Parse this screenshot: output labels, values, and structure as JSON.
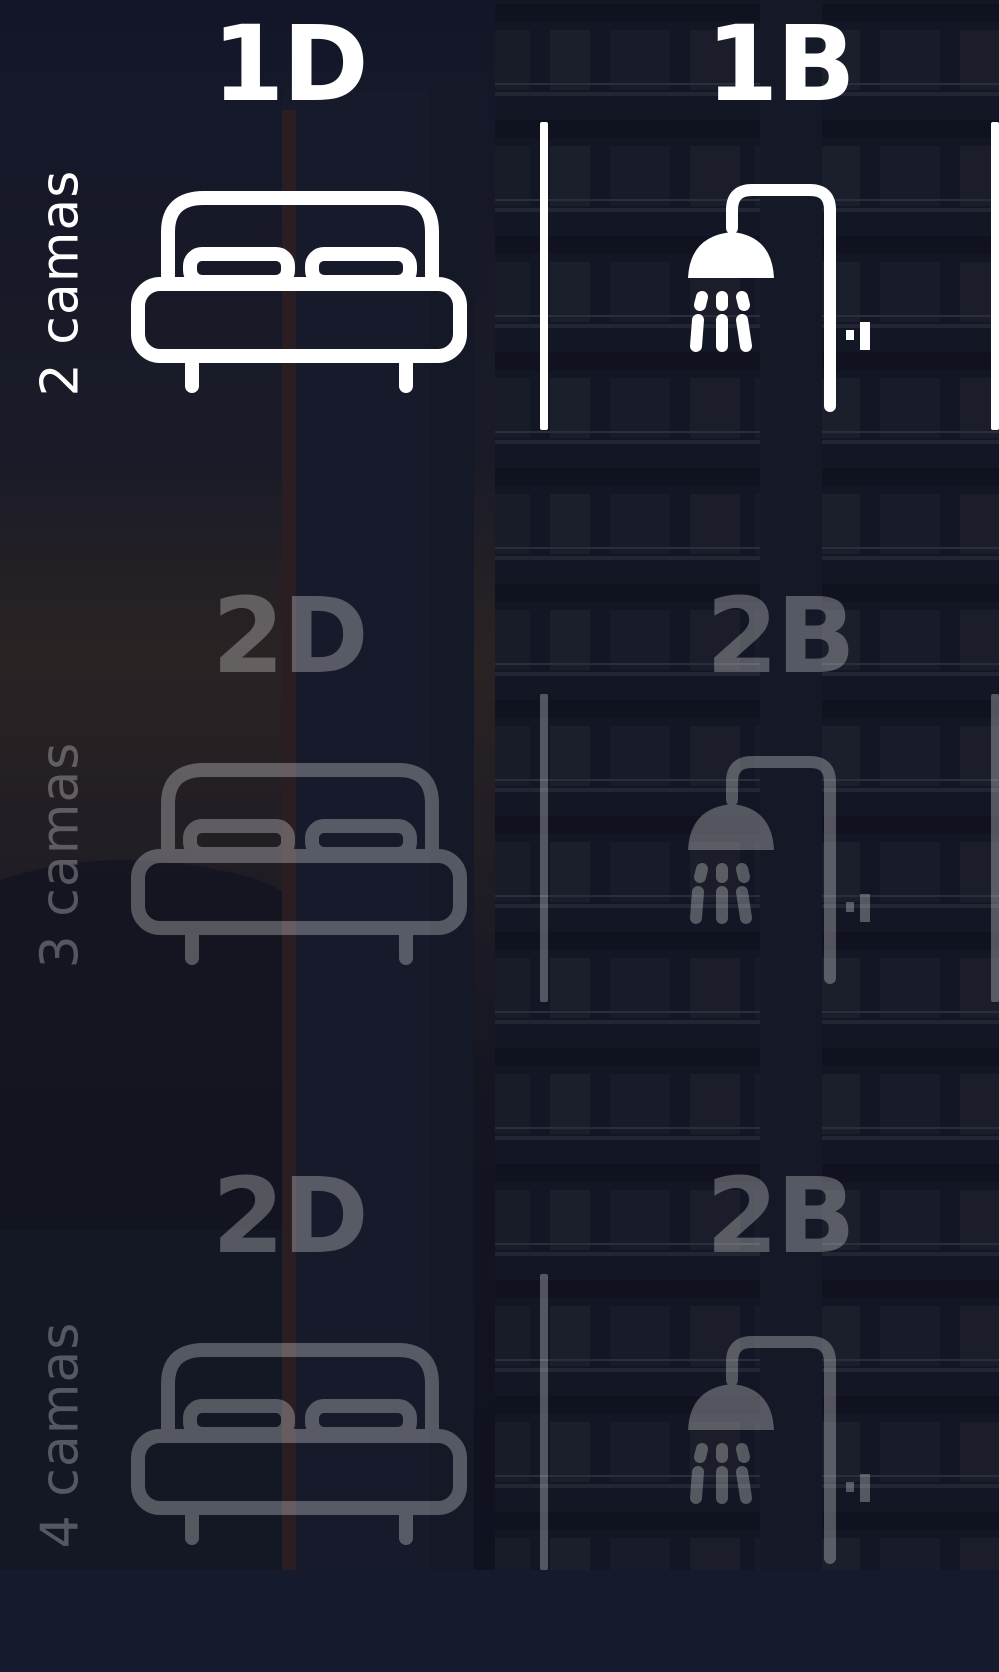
{
  "options": [
    {
      "beds": "2 camas",
      "dorm": "1D",
      "bath": "1B",
      "bed_icon": "double-bed-icon",
      "bath_icon": "shower-icon",
      "active": true
    },
    {
      "beds": "3 camas",
      "dorm": "2D",
      "bath": "2B",
      "bed_icon": "double-bed-icon",
      "bath_icon": "shower-icon",
      "active": false
    },
    {
      "beds": "4 camas",
      "dorm": "2D",
      "bath": "2B",
      "bed_icon": "double-bed-icon",
      "bath_icon": "shower-icon",
      "active": false
    }
  ],
  "colors": {
    "text": "#ffffff",
    "background": "#151a2c",
    "sky_glow": "#6a4a2a"
  }
}
